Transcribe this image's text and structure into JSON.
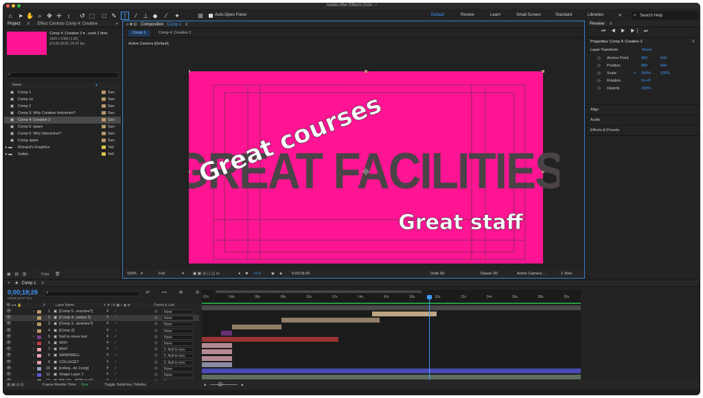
{
  "window": {
    "title": "Adobe After Effects 2024 - /"
  },
  "toolbar": {
    "auto_open": "Auto-Open Panel",
    "workspaces": [
      "Default",
      "Review",
      "Learn",
      "Small Screen",
      "Standard",
      "Libraries"
    ],
    "search_placeholder": "Search Help"
  },
  "project": {
    "tabs": [
      "Project",
      "Effect Controls Comp 4: Creative"
    ],
    "selected_name": "Comp 4: Creative  2 ▾ , used 1 time",
    "selected_size": "1920 x 1080 (1.00)",
    "selected_duration": "Δ 0;00;30;00, 29.97 fps",
    "search_placeholder": "",
    "col_name": "Name",
    "items": [
      {
        "name": "Comp 1",
        "label": "San",
        "color": "#b89a6a"
      },
      {
        "name": "Comp 1e",
        "label": "San",
        "color": "#b89a6a"
      },
      {
        "name": "Comp 2",
        "label": "San",
        "color": "#b89a6a"
      },
      {
        "name": "Comp 3: Why Creative Industries?",
        "label": "San",
        "color": "#b89a6a"
      },
      {
        "name": "Comp 4: Creative  2",
        "label": "San",
        "color": "#b89a6a"
      },
      {
        "name": "Comp 5: spare",
        "label": "San",
        "color": "#b89a6a"
      },
      {
        "name": "Comp 5: Why Interactive?",
        "label": "San",
        "color": "#b89a6a"
      },
      {
        "name": "Comp spare",
        "label": "San",
        "color": "#b89a6a"
      },
      {
        "name": "Richard's Graphics",
        "label": "Yell",
        "color": "#d6c64a"
      },
      {
        "name": "Solids",
        "label": "Yell",
        "color": "#d6c64a"
      }
    ],
    "bpc": "8 bpc"
  },
  "composition": {
    "tab_title": "Composition",
    "tab_comp": "Comp 1",
    "sub_tabs": [
      "Comp 1",
      "Comp 4: Creative  2"
    ],
    "camera_label": "Active Camera (Default)",
    "text_main": "GREAT FACILITIES",
    "text_courses": "Great courses",
    "text_staff": "Great staff",
    "bg_color": "#ff1493",
    "zoom": "100%",
    "resolution": "Full",
    "exposure": "+0.0",
    "timecode": "0;00;18;29",
    "renderer": "Draft 3D",
    "mode_3d": "Classic 3D",
    "camera_view": "Active Camera ...",
    "views": "1 View"
  },
  "preview": {
    "title": "Preview"
  },
  "properties": {
    "title": "Properties: Comp 4: Creative  2",
    "section": "Layer Transform",
    "reset": "Reset",
    "rows": [
      {
        "label": "Anchor Point",
        "v1": "960",
        "v2": "540"
      },
      {
        "label": "Position",
        "v1": "960",
        "v2": "540"
      },
      {
        "label": "Scale",
        "v1": "100%",
        "v2": "100%"
      },
      {
        "label": "Rotation",
        "v1": "0x+0°",
        "v2": ""
      },
      {
        "label": "Opacity",
        "v1": "100%",
        "v2": ""
      }
    ],
    "panels": [
      "Align",
      "Audio",
      "Effects & Presets"
    ]
  },
  "timeline": {
    "tab": "Comp 1",
    "timecode": "0;00;18;29",
    "fps_info": "00569 (29.97 fps)",
    "col_layer": "Layer Name",
    "col_parent": "Parent & Link",
    "ruler": [
      "02s",
      "04s",
      "06s",
      "08s",
      "10s",
      "12s",
      "14s",
      "16s",
      "18s",
      "20s",
      "22s",
      "24s",
      "26s",
      "28s",
      "30s"
    ],
    "layers": [
      {
        "num": "1",
        "name": "[Comp 5...eractive?]",
        "parent": "None",
        "color": "#b89a6a",
        "bar": [
          0,
          1
        ],
        "bar_color": "#4a4a4a"
      },
      {
        "num": "2",
        "name": "[Comp 4...eative  2]",
        "parent": "None",
        "color": "#b89a6a",
        "bar": [
          0.45,
          0.62
        ],
        "bar_color": "#bfa583"
      },
      {
        "num": "3",
        "name": "[Comp 3...dustries?]",
        "parent": "None",
        "color": "#b89a6a",
        "bar": [
          0.21,
          0.47
        ],
        "bar_color": "#8f7f66"
      },
      {
        "num": "4",
        "name": "[Comp 2]",
        "parent": "None",
        "color": "#b89a6a",
        "bar": [
          0.08,
          0.21
        ],
        "bar_color": "#8f7f66"
      },
      {
        "num": "5",
        "name": "Null to move text",
        "parent": "None",
        "color": "#7a3b8c",
        "bar": [
          0.05,
          0.08
        ],
        "bar_color": "#6a3075"
      },
      {
        "num": "6",
        "name": "WHY",
        "parent": "None",
        "color": "#c04040",
        "bar": [
          0,
          0.36
        ],
        "bar_color": "#9a3434"
      },
      {
        "num": "7",
        "name": "WHY",
        "parent": "5. Null to mov",
        "color": "#e8a0b0",
        "bar": [
          0,
          0.08
        ],
        "bar_color": "#b58a95"
      },
      {
        "num": "8",
        "name": "SANDWELL",
        "parent": "5. Null to mov",
        "color": "#e8a0b0",
        "bar": [
          0,
          0.08
        ],
        "bar_color": "#b58a95"
      },
      {
        "num": "9",
        "name": "COLLEGE?",
        "parent": "5. Null to mov",
        "color": "#e8a0b0",
        "bar": [
          0,
          0.08
        ],
        "bar_color": "#b58a95"
      },
      {
        "num": "10",
        "name": "[colleg...ite 2.png]",
        "parent": "None",
        "color": "#9aa0c0",
        "bar": [
          0,
          0.08
        ],
        "bar_color": "#8a8aa0"
      },
      {
        "num": "11",
        "name": "Shape Layer 1",
        "parent": "None",
        "color": "#5b5bd6",
        "bar": [
          0,
          1
        ],
        "bar_color": "#4a4ab5"
      },
      {
        "num": "12",
        "name": "[9th Wo...BPM.mp3]",
        "parent": "None",
        "color": "#9ad0a0",
        "bar": [
          0,
          1
        ],
        "bar_color": "#5e6e60"
      }
    ],
    "footer_render": "Frame Render Time",
    "footer_render_val": "2ms",
    "footer_toggle": "Toggle Switches / Modes",
    "playhead": 0.6
  }
}
